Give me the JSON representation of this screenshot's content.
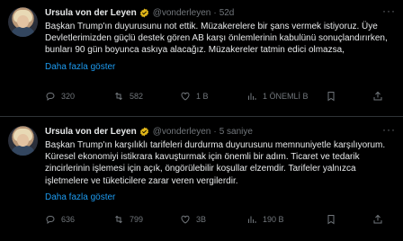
{
  "tweets": [
    {
      "name": "Ursula von der Leyen",
      "handle": "@vonderleyen",
      "time": "52d",
      "text": "Başkan Trump'ın duyurusunu not ettik. Müzakerelere bir şans vermek istiyoruz. Üye Devletlerimizden güçlü destek gören AB karşı önlemlerinin kabulünü sonuçlandırırken, bunları 90 gün boyunca askıya alacağız. Müzakereler tatmin edici olmazsa,",
      "show_more": "Daha fazla göster",
      "replies": "320",
      "retweets": "582",
      "likes": "1 B",
      "views": "1 ÖNEMLİ B"
    },
    {
      "name": "Ursula von der Leyen",
      "handle": "@vonderleyen",
      "time": "5 saniye",
      "text": "Başkan Trump'ın karşılıklı tarifeleri durdurma duyurusunu memnuniyetle karşılıyorum. Küresel ekonomiyi istikrara kavuşturmak için önemli bir adım. Ticaret ve tedarik zincirlerinin işlemesi için açık, öngörülebilir koşullar elzemdir. Tarifeler yalnızca işletmelere ve tüketicilere zarar veren vergilerdir.",
      "show_more": "Daha fazla göster",
      "replies": "636",
      "retweets": "799",
      "likes": "3B",
      "views": "190 B"
    }
  ],
  "icons": {
    "verified": "verified-badge-icon",
    "more": "more-options-icon",
    "reply": "reply-icon",
    "retweet": "retweet-icon",
    "like": "heart-icon",
    "views": "views-chart-icon",
    "bookmark": "bookmark-icon",
    "share": "share-icon"
  },
  "colors": {
    "background": "#000000",
    "text": "#e7e9ea",
    "muted": "#71767b",
    "link": "#1d9bf0",
    "verified": "#e2b719"
  }
}
